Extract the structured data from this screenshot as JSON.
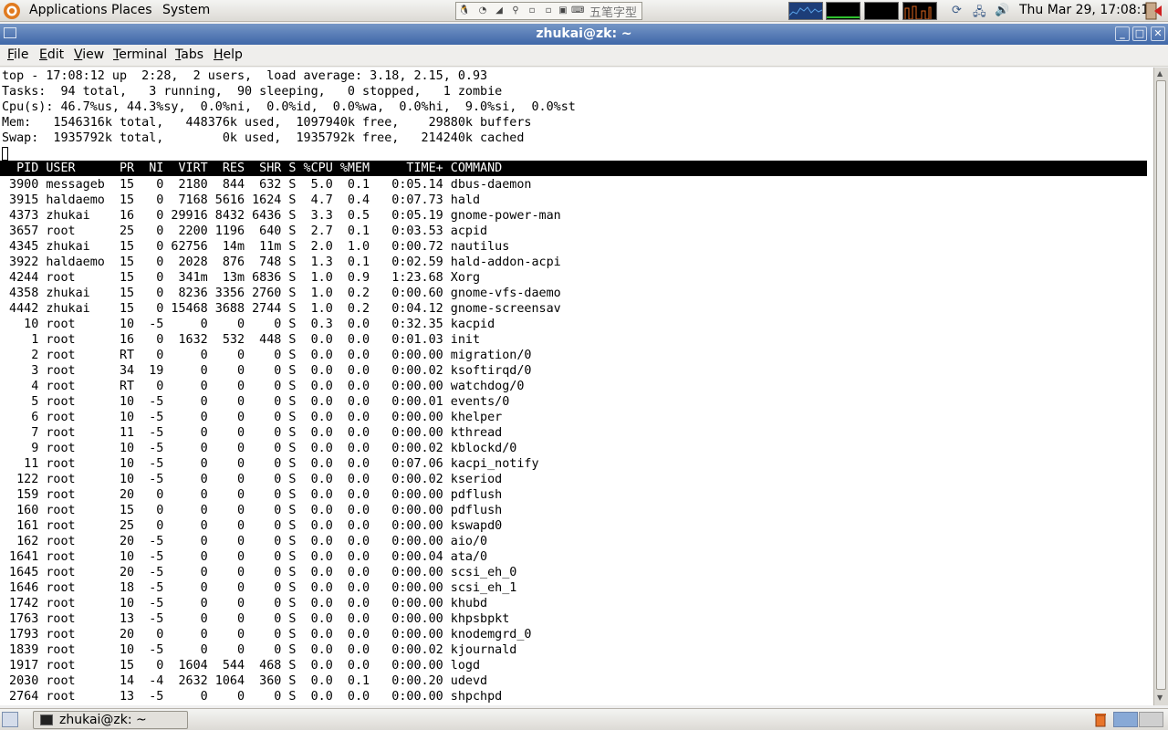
{
  "panel": {
    "menus": {
      "applications": "Applications",
      "places": "Places",
      "system": "System"
    },
    "ime_label": "五笔字型",
    "clock": "Thu Mar 29, 17:08:12"
  },
  "window": {
    "title": "zhukai@zk: ~"
  },
  "menubar": {
    "items": [
      {
        "key": "F",
        "rest": "ile"
      },
      {
        "key": "E",
        "rest": "dit"
      },
      {
        "key": "V",
        "rest": "iew"
      },
      {
        "key": "T",
        "rest": "erminal"
      },
      {
        "key": "T",
        "rest": "abs",
        "pre": ""
      },
      {
        "key": "H",
        "rest": "elp"
      }
    ]
  },
  "top": {
    "summary": [
      "top - 17:08:12 up  2:28,  2 users,  load average: 3.18, 2.15, 0.93",
      "Tasks:  94 total,   3 running,  90 sleeping,   0 stopped,   1 zombie",
      "Cpu(s): 46.7%us, 44.3%sy,  0.0%ni,  0.0%id,  0.0%wa,  0.0%hi,  9.0%si,  0.0%st",
      "Mem:   1546316k total,   448376k used,  1097940k free,    29880k buffers",
      "Swap:  1935792k total,        0k used,  1935792k free,   214240k cached"
    ],
    "columns": [
      "PID",
      "USER",
      "PR",
      "NI",
      "VIRT",
      "RES",
      "SHR",
      "S",
      "%CPU",
      "%MEM",
      "TIME+",
      "COMMAND"
    ],
    "processes": [
      [
        "3900",
        "messageb",
        "15",
        "0",
        "2180",
        "844",
        "632",
        "S",
        "5.0",
        "0.1",
        "0:05.14",
        "dbus-daemon"
      ],
      [
        "3915",
        "haldaemo",
        "15",
        "0",
        "7168",
        "5616",
        "1624",
        "S",
        "4.7",
        "0.4",
        "0:07.73",
        "hald"
      ],
      [
        "4373",
        "zhukai",
        "16",
        "0",
        "29916",
        "8432",
        "6436",
        "S",
        "3.3",
        "0.5",
        "0:05.19",
        "gnome-power-man"
      ],
      [
        "3657",
        "root",
        "25",
        "0",
        "2200",
        "1196",
        "640",
        "S",
        "2.7",
        "0.1",
        "0:03.53",
        "acpid"
      ],
      [
        "4345",
        "zhukai",
        "15",
        "0",
        "62756",
        "14m",
        "11m",
        "S",
        "2.0",
        "1.0",
        "0:00.72",
        "nautilus"
      ],
      [
        "3922",
        "haldaemo",
        "15",
        "0",
        "2028",
        "876",
        "748",
        "S",
        "1.3",
        "0.1",
        "0:02.59",
        "hald-addon-acpi"
      ],
      [
        "4244",
        "root",
        "15",
        "0",
        "341m",
        "13m",
        "6836",
        "S",
        "1.0",
        "0.9",
        "1:23.68",
        "Xorg"
      ],
      [
        "4358",
        "zhukai",
        "15",
        "0",
        "8236",
        "3356",
        "2760",
        "S",
        "1.0",
        "0.2",
        "0:00.60",
        "gnome-vfs-daemo"
      ],
      [
        "4442",
        "zhukai",
        "15",
        "0",
        "15468",
        "3688",
        "2744",
        "S",
        "1.0",
        "0.2",
        "0:04.12",
        "gnome-screensav"
      ],
      [
        "10",
        "root",
        "10",
        "-5",
        "0",
        "0",
        "0",
        "S",
        "0.3",
        "0.0",
        "0:32.35",
        "kacpid"
      ],
      [
        "1",
        "root",
        "16",
        "0",
        "1632",
        "532",
        "448",
        "S",
        "0.0",
        "0.0",
        "0:01.03",
        "init"
      ],
      [
        "2",
        "root",
        "RT",
        "0",
        "0",
        "0",
        "0",
        "S",
        "0.0",
        "0.0",
        "0:00.00",
        "migration/0"
      ],
      [
        "3",
        "root",
        "34",
        "19",
        "0",
        "0",
        "0",
        "S",
        "0.0",
        "0.0",
        "0:00.02",
        "ksoftirqd/0"
      ],
      [
        "4",
        "root",
        "RT",
        "0",
        "0",
        "0",
        "0",
        "S",
        "0.0",
        "0.0",
        "0:00.00",
        "watchdog/0"
      ],
      [
        "5",
        "root",
        "10",
        "-5",
        "0",
        "0",
        "0",
        "S",
        "0.0",
        "0.0",
        "0:00.01",
        "events/0"
      ],
      [
        "6",
        "root",
        "10",
        "-5",
        "0",
        "0",
        "0",
        "S",
        "0.0",
        "0.0",
        "0:00.00",
        "khelper"
      ],
      [
        "7",
        "root",
        "11",
        "-5",
        "0",
        "0",
        "0",
        "S",
        "0.0",
        "0.0",
        "0:00.00",
        "kthread"
      ],
      [
        "9",
        "root",
        "10",
        "-5",
        "0",
        "0",
        "0",
        "S",
        "0.0",
        "0.0",
        "0:00.02",
        "kblockd/0"
      ],
      [
        "11",
        "root",
        "10",
        "-5",
        "0",
        "0",
        "0",
        "S",
        "0.0",
        "0.0",
        "0:07.06",
        "kacpi_notify"
      ],
      [
        "122",
        "root",
        "10",
        "-5",
        "0",
        "0",
        "0",
        "S",
        "0.0",
        "0.0",
        "0:00.02",
        "kseriod"
      ],
      [
        "159",
        "root",
        "20",
        "0",
        "0",
        "0",
        "0",
        "S",
        "0.0",
        "0.0",
        "0:00.00",
        "pdflush"
      ],
      [
        "160",
        "root",
        "15",
        "0",
        "0",
        "0",
        "0",
        "S",
        "0.0",
        "0.0",
        "0:00.00",
        "pdflush"
      ],
      [
        "161",
        "root",
        "25",
        "0",
        "0",
        "0",
        "0",
        "S",
        "0.0",
        "0.0",
        "0:00.00",
        "kswapd0"
      ],
      [
        "162",
        "root",
        "20",
        "-5",
        "0",
        "0",
        "0",
        "S",
        "0.0",
        "0.0",
        "0:00.00",
        "aio/0"
      ],
      [
        "1641",
        "root",
        "10",
        "-5",
        "0",
        "0",
        "0",
        "S",
        "0.0",
        "0.0",
        "0:00.04",
        "ata/0"
      ],
      [
        "1645",
        "root",
        "20",
        "-5",
        "0",
        "0",
        "0",
        "S",
        "0.0",
        "0.0",
        "0:00.00",
        "scsi_eh_0"
      ],
      [
        "1646",
        "root",
        "18",
        "-5",
        "0",
        "0",
        "0",
        "S",
        "0.0",
        "0.0",
        "0:00.00",
        "scsi_eh_1"
      ],
      [
        "1742",
        "root",
        "10",
        "-5",
        "0",
        "0",
        "0",
        "S",
        "0.0",
        "0.0",
        "0:00.00",
        "khubd"
      ],
      [
        "1763",
        "root",
        "13",
        "-5",
        "0",
        "0",
        "0",
        "S",
        "0.0",
        "0.0",
        "0:00.00",
        "khpsbpkt"
      ],
      [
        "1793",
        "root",
        "20",
        "0",
        "0",
        "0",
        "0",
        "S",
        "0.0",
        "0.0",
        "0:00.00",
        "knodemgrd_0"
      ],
      [
        "1839",
        "root",
        "10",
        "-5",
        "0",
        "0",
        "0",
        "S",
        "0.0",
        "0.0",
        "0:00.02",
        "kjournald"
      ],
      [
        "1917",
        "root",
        "15",
        "0",
        "1604",
        "544",
        "468",
        "S",
        "0.0",
        "0.0",
        "0:00.00",
        "logd"
      ],
      [
        "2030",
        "root",
        "14",
        "-4",
        "2632",
        "1064",
        "360",
        "S",
        "0.0",
        "0.1",
        "0:00.20",
        "udevd"
      ],
      [
        "2764",
        "root",
        "13",
        "-5",
        "0",
        "0",
        "0",
        "S",
        "0.0",
        "0.0",
        "0:00.00",
        "shpchpd"
      ]
    ]
  },
  "taskbar": {
    "task_label": "zhukai@zk: ~"
  },
  "icons": {
    "menu_foot": "gnome-foot-icon",
    "terminal": "terminal-icon",
    "logout": "logout-icon",
    "trash": "trash-icon",
    "network": "network-icon",
    "volume": "volume-icon"
  },
  "colors": {
    "titlebar": "#4a71ae",
    "terminal_bg": "#ffffff",
    "header_bar": "#000000"
  }
}
